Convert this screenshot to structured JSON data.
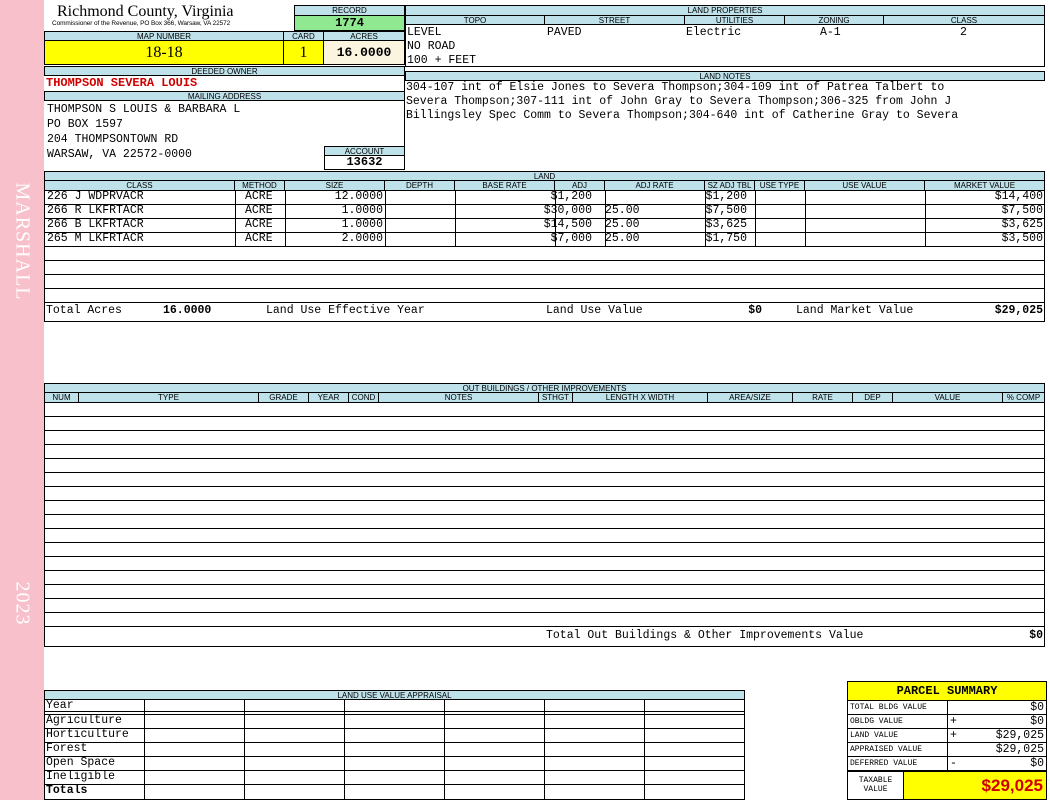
{
  "sidebar": {
    "name": "MARSHALL",
    "year": "2023"
  },
  "header": {
    "county": "Richmond County, Virginia",
    "subtitle": "Commissioner of the Revenue, PO Box 366, Warsaw, VA 22572",
    "record_label": "RECORD",
    "record": "1774",
    "map_number_label": "MAP NUMBER",
    "map_number": "18-18",
    "card_label": "CARD",
    "card": "1",
    "acres_label": "ACRES",
    "acres": "16.0000"
  },
  "owner": {
    "deeded_owner_label": "DEEDED OWNER",
    "deeded_owner": "THOMPSON SEVERA LOUIS",
    "mailing_label": "MAILING ADDRESS",
    "mailing": [
      "THOMPSON S LOUIS & BARBARA L",
      "PO BOX 1597",
      "204 THOMPSONTOWN RD",
      "WARSAW, VA 22572-0000"
    ],
    "account_label": "ACCOUNT",
    "account": "13632"
  },
  "land_properties": {
    "title": "LAND PROPERTIES",
    "headers": [
      "TOPO",
      "STREET",
      "UTILITIES",
      "ZONING",
      "CLASS"
    ],
    "topo": [
      "LEVEL",
      "NO ROAD",
      "100 + FEET"
    ],
    "street": "PAVED",
    "utilities": "Electric",
    "zoning": "A-1",
    "class": "2"
  },
  "land_notes": {
    "title": "LAND NOTES",
    "lines": [
      "304-107 int of Elsie Jones to Severa Thompson;304-109 int of Patrea Talbert to",
      "Severa Thompson;307-111 int of John Gray to Severa Thompson;306-325 from John J",
      "Billingsley Spec Comm to Severa Thompson;304-640 int of Catherine Gray to Severa"
    ]
  },
  "land": {
    "title": "LAND",
    "headers": [
      "CLASS",
      "METHOD",
      "SIZE",
      "DEPTH",
      "BASE RATE",
      "ADJ",
      "ADJ RATE",
      "SZ ADJ TBL",
      "USE TYPE",
      "USE VALUE",
      "MARKET VALUE"
    ],
    "rows": [
      {
        "class": "226 J WDPRVACR",
        "method": "ACRE",
        "size": "12.0000",
        "depth": "",
        "base_rate": "$1,200",
        "adj": "",
        "adj_rate": "$1,200",
        "sz_adj": "",
        "use_type": "",
        "use_value": "",
        "market": "$14,400"
      },
      {
        "class": "266 R LKFRTACR",
        "method": "ACRE",
        "size": "1.0000",
        "depth": "",
        "base_rate": "$30,000",
        "adj": "25.00",
        "adj_rate": "$7,500",
        "sz_adj": "",
        "use_type": "",
        "use_value": "",
        "market": "$7,500"
      },
      {
        "class": "266 B LKFRTACR",
        "method": "ACRE",
        "size": "1.0000",
        "depth": "",
        "base_rate": "$14,500",
        "adj": "25.00",
        "adj_rate": "$3,625",
        "sz_adj": "",
        "use_type": "",
        "use_value": "",
        "market": "$3,625"
      },
      {
        "class": "265 M LKFRTACR",
        "method": "ACRE",
        "size": "2.0000",
        "depth": "",
        "base_rate": "$7,000",
        "adj": "25.00",
        "adj_rate": "$1,750",
        "sz_adj": "",
        "use_type": "",
        "use_value": "",
        "market": "$3,500"
      }
    ],
    "total_acres_label": "Total Acres",
    "total_acres": "16.0000",
    "effective_year_label": "Land Use Effective Year",
    "use_value_label": "Land Use Value",
    "use_value": "$0",
    "market_value_label": "Land Market Value",
    "market_value": "$29,025"
  },
  "outbuildings": {
    "title": "OUT BUILDINGS / OTHER IMPROVEMENTS",
    "headers": [
      "NUM",
      "TYPE",
      "GRADE",
      "YEAR",
      "COND",
      "NOTES",
      "STHGT",
      "LENGTH X WIDTH",
      "AREA/SIZE",
      "RATE",
      "DEP",
      "VALUE",
      "% COMP"
    ],
    "total_label": "Total Out Buildings & Other Improvements Value",
    "total": "$0"
  },
  "land_use": {
    "title": "LAND USE VALUE APPRAISAL",
    "year_label": "Year",
    "rows": [
      "Agriculture",
      "Horticulture",
      "Forest",
      "Open Space",
      "Ineligible"
    ],
    "totals_label": "Totals"
  },
  "summary": {
    "title": "PARCEL SUMMARY",
    "rows": [
      {
        "label": "TOTAL BLDG VALUE",
        "op": "",
        "value": "$0"
      },
      {
        "label": "OBLDG VALUE",
        "op": "+",
        "value": "$0"
      },
      {
        "label": "LAND VALUE",
        "op": "+",
        "value": "$29,025"
      },
      {
        "label": "APPRAISED VALUE",
        "op": "",
        "value": "$29,025"
      },
      {
        "label": "DEFERRED VALUE",
        "op": "-",
        "value": "$0"
      }
    ],
    "taxable_label_1": "TAXABLE",
    "taxable_label_2": "VALUE",
    "taxable": "$29,025"
  },
  "colors": {
    "header_blue": "#bfe1ea",
    "yellow": "#ffff00",
    "green": "#90e890",
    "pink": "#f8c0cb",
    "red": "#d00000"
  }
}
